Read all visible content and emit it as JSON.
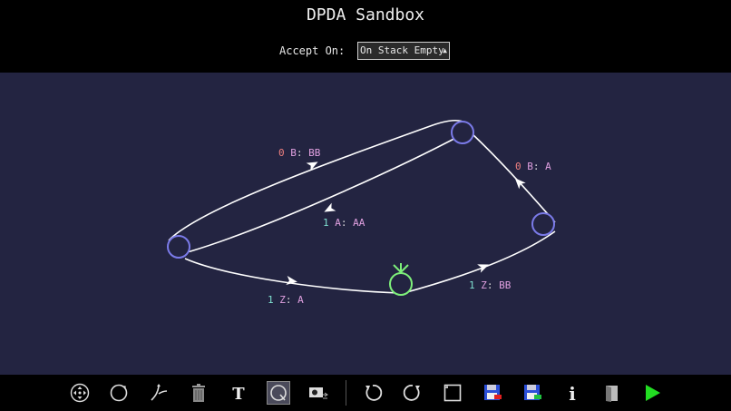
{
  "app": {
    "title": "DPDA Sandbox"
  },
  "accept": {
    "label": "Accept On:",
    "selected": "On Stack Empty"
  },
  "transitions": [
    {
      "input": "0",
      "pop": "B",
      "push": "BB"
    },
    {
      "input": "1",
      "pop": "A",
      "push": "AA"
    },
    {
      "input": "0",
      "pop": "B",
      "push": "A"
    },
    {
      "input": "1",
      "pop": "Z",
      "push": "A"
    },
    {
      "input": "1",
      "pop": "Z",
      "push": "BB"
    }
  ],
  "colors": {
    "canvas_bg": "#232441",
    "state_stroke": "#7a7ae8",
    "start_state_stroke": "#7ef07a",
    "edge": "#ffffff",
    "input_zero": "#f08080",
    "input_one": "#7fe0d0",
    "stack_symbol": "#e0a0e0"
  },
  "toolbar": {
    "tools": [
      {
        "name": "move-tool",
        "icon": "move-arrows-icon"
      },
      {
        "name": "add-state-tool",
        "icon": "circle-icon"
      },
      {
        "name": "add-transition-tool",
        "icon": "transition-arrow-icon"
      },
      {
        "name": "delete-tool",
        "icon": "trash-icon"
      },
      {
        "name": "text-tool",
        "icon": "text-icon"
      },
      {
        "name": "final-state-tool",
        "icon": "final-state-icon",
        "active": true
      },
      {
        "name": "image-tool",
        "icon": "image-icon"
      },
      {
        "name": "undo-button",
        "icon": "undo-icon"
      },
      {
        "name": "redo-button",
        "icon": "redo-icon"
      },
      {
        "name": "clear-button",
        "icon": "blank-canvas-icon"
      },
      {
        "name": "save-export-button",
        "icon": "save-red-icon"
      },
      {
        "name": "save-import-button",
        "icon": "save-green-icon"
      },
      {
        "name": "info-button",
        "icon": "info-icon"
      },
      {
        "name": "book-button",
        "icon": "book-icon"
      },
      {
        "name": "run-button",
        "icon": "play-icon"
      }
    ]
  }
}
